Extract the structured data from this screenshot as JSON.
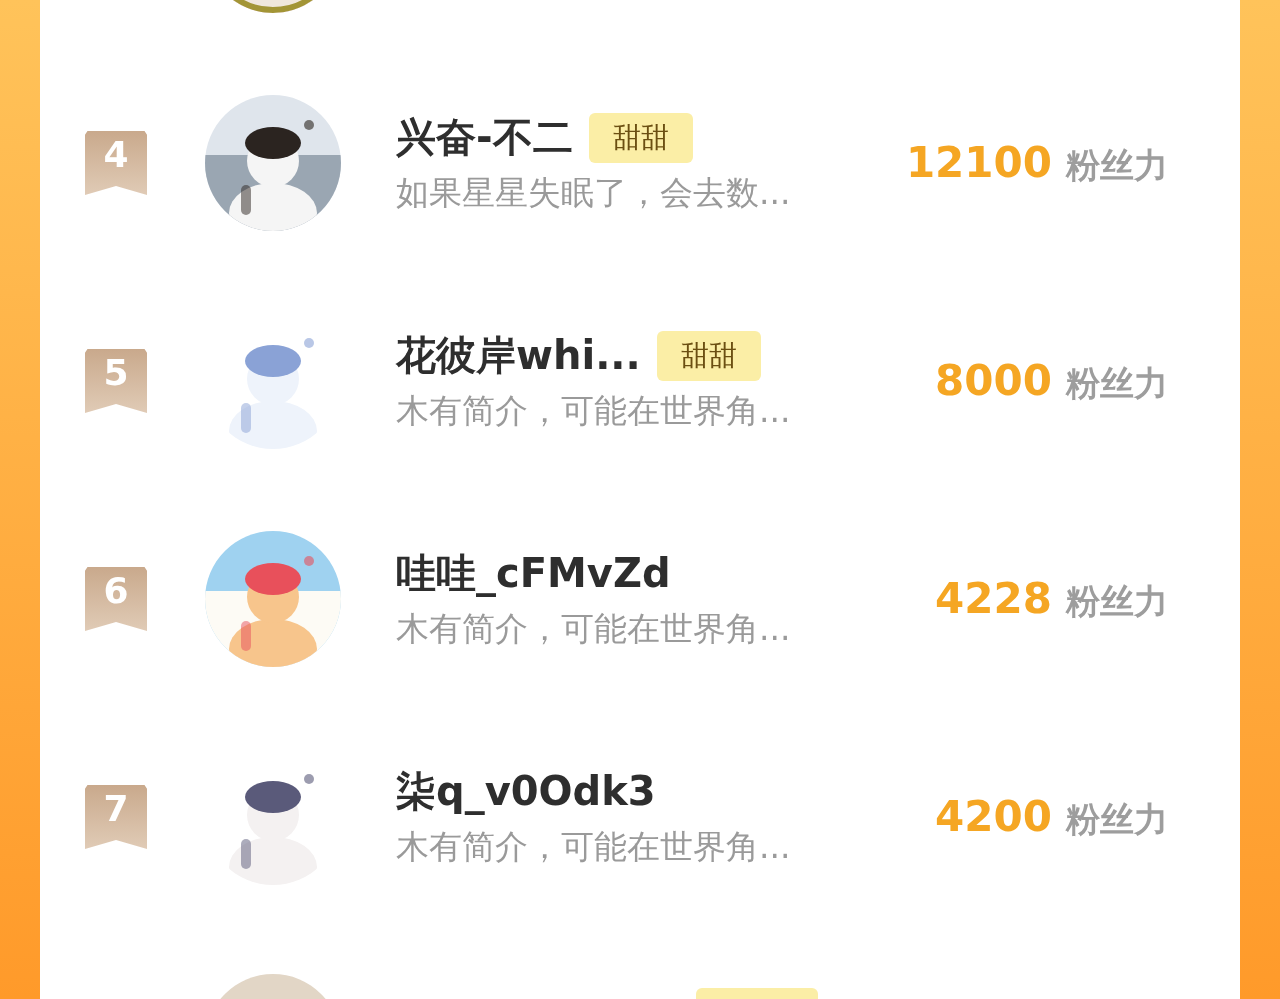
{
  "top_avatar": {
    "kind": "picture",
    "ringed": true
  },
  "rows": [
    {
      "rank": "4",
      "name": "兴奋-不二",
      "tag": "甜甜",
      "bio": "如果星星失眠了，会去数...",
      "score": "12100",
      "unit": "粉丝力",
      "avatar": {
        "kind": "picture"
      }
    },
    {
      "rank": "5",
      "name": "花彼岸whi...",
      "tag": "甜甜",
      "bio": "木有简介，可能在世界角...",
      "score": "8000",
      "unit": "粉丝力",
      "avatar": {
        "kind": "picture"
      }
    },
    {
      "rank": "6",
      "name": "哇哇_cFMvZd",
      "bio": "木有简介，可能在世界角...",
      "score": "4228",
      "unit": "粉丝力",
      "avatar": {
        "kind": "picture"
      }
    },
    {
      "rank": "7",
      "name": "柒q_v0Odk3",
      "bio": "木有简介，可能在世界角...",
      "score": "4200",
      "unit": "粉丝力",
      "avatar": {
        "kind": "picture"
      }
    }
  ],
  "bottom_row": {
    "kind": "picture",
    "tag_shown": true
  }
}
